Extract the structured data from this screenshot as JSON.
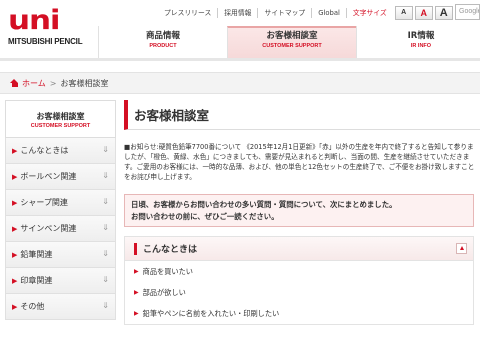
{
  "brand": {
    "logo_text": "uni",
    "company": "MITSUBISHI PENCIL"
  },
  "util_nav": [
    "プレスリリース",
    "採用情報",
    "サイトマップ",
    "Global",
    "文字サイズ"
  ],
  "font_size_buttons": [
    "A",
    "A",
    "A"
  ],
  "search": {
    "placeholder": "Google"
  },
  "global_nav": [
    {
      "jp": "商品情報",
      "en": "PRODUCT"
    },
    {
      "jp": "お客様相談室",
      "en": "CUSTOMER SUPPORT"
    },
    {
      "jp": "IR情報",
      "en": "IR INFO"
    }
  ],
  "breadcrumb": {
    "home": "ホーム",
    "separator": ">",
    "current": "お客様相談室"
  },
  "sidebar": {
    "title_jp": "お客様相談室",
    "title_en": "CUSTOMER SUPPORT",
    "items": [
      {
        "label": "こんなときは"
      },
      {
        "label": "ボールペン関連"
      },
      {
        "label": "シャープ関連"
      },
      {
        "label": "サインペン関連"
      },
      {
        "label": "鉛筆関連"
      },
      {
        "label": "印章関連"
      },
      {
        "label": "その他"
      }
    ],
    "arrow": "▶",
    "download_glyph": "⇓"
  },
  "main": {
    "heading": "お客様相談室",
    "notice": "■お知らせ:硬質色鉛筆7700番について 《2015年12月1日更新》「赤」以外の生産を年内で終了すると告知して参りましたが、「橙色、黄緑、水色」につきましても、需要が見込まれると判断し、当面の間、生産を継続させていただきます。ご愛用のお客様には、一時的な品薄、および、他の単色と12色セットの生産終了で、ご不便をお掛け致しますことをお詫び申し上げます。",
    "alert_line1": "日頃、お客様からお問い合わせの多い質問・質問について、次にまとめました。",
    "alert_line2": "お問い合わせの前に、ぜひご一読ください。",
    "faq": {
      "title": "こんなときは",
      "links": [
        "商品を買いたい",
        "部品が欲しい",
        "鉛筆やペンに名前を入れたい・印刷したい"
      ],
      "arrow": "▶"
    }
  },
  "colors": {
    "accent": "#d40f24",
    "nav_current_bg": "#fbe7e7",
    "alert_bg": "#fdf1f1"
  }
}
